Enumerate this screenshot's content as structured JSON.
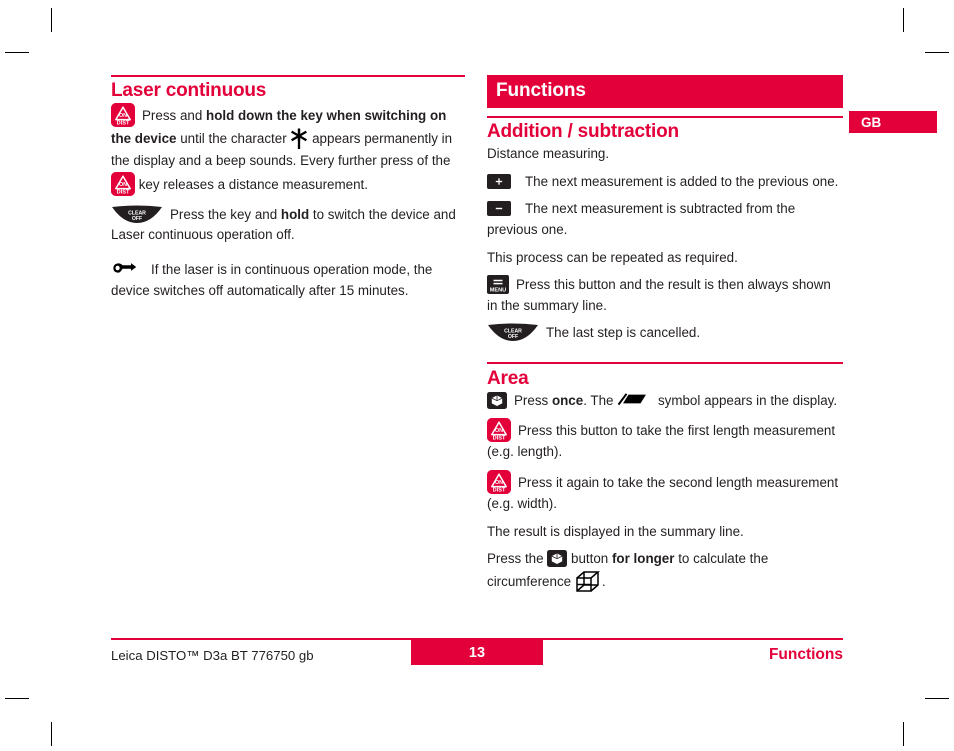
{
  "meta": {
    "language_tab": "GB"
  },
  "left_column": {
    "heading": "Laser continuous",
    "para1": {
      "icon": "on-dist-key-icon",
      "seg1": "Press and ",
      "seg2_bold": "hold down the key when switching on the device",
      "seg3": " until the character ",
      "inline_icon": "laser-asterisk-icon",
      "seg4": " appears permanently in the display and a beep sounds. Every further press of the ",
      "inline_icon2": "on-dist-key-icon",
      "seg5": " key releases a distance measurement."
    },
    "para2": {
      "icon": "clear-off-key-icon",
      "seg1": "Press the key and ",
      "seg2_bold": "hold",
      "seg3": " to switch the device and Laser continuous operation off."
    },
    "para3": {
      "icon": "pointing-hand-icon",
      "text": "If the laser is in continuous operation mode, the device switches off automatically after 15 minutes."
    }
  },
  "right_column": {
    "chapter_band": "Functions",
    "section1_heading": "Addition / subtraction",
    "intro": "Distance measuring.",
    "add_item": {
      "icon": "plus-key-icon",
      "text": "The next measurement is added to the previous one."
    },
    "sub_item": {
      "icon": "minus-key-icon",
      "text": "The next measurement is subtracted from the previous one."
    },
    "repeat_text": "This process can be repeated as required.",
    "menu_item": {
      "icon": "menu-key-icon",
      "text": "Press this button and the result is then always shown in the summary line."
    },
    "clear_item": {
      "icon": "clear-off-key-icon",
      "text": "The last step is cancelled."
    },
    "section2_heading": "Area",
    "area_item1": {
      "icon": "function-cube-key-icon",
      "seg1": "Press ",
      "seg2_bold": "once",
      "seg3": ". The ",
      "inline_icon": "area-parallelogram-icon",
      "seg4": " symbol appears in the display."
    },
    "area_item2": {
      "icon": "on-dist-key-icon",
      "text": "Press this button to take the first length measurement (e.g. length)."
    },
    "area_item3": {
      "icon": "on-dist-key-icon",
      "text": "Press it again to take the second length measurement (e.g. width)."
    },
    "area_result": "The result is displayed in the summary line.",
    "area_item4": {
      "seg1": "Press the ",
      "inline_icon": "function-cube-key-icon",
      "seg2": " button ",
      "seg3_bold": "for longer",
      "seg4": " to calculate the circumference ",
      "inline_icon2": "wireframe-cube-icon",
      "seg5": "."
    }
  },
  "footer": {
    "left": "Leica DISTO™ D3a BT 776750 gb",
    "page_number": "13",
    "right": "Functions"
  },
  "colors": {
    "brand_red": "#e3003a",
    "text_black": "#231f20",
    "key_dark": "#231f20"
  }
}
